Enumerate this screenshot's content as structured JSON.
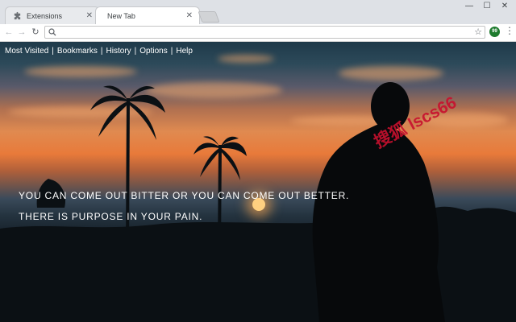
{
  "tabs": [
    {
      "label": "Extensions",
      "icon": "puzzle-icon",
      "active": false
    },
    {
      "label": "New Tab",
      "active": true
    }
  ],
  "toolbar": {
    "back": "←",
    "forward": "→",
    "reload": "↻",
    "address_value": "",
    "address_placeholder": "",
    "star": "☆",
    "extension_badge": "99",
    "menu": "⋮"
  },
  "window_controls": {
    "minimize": "—",
    "maximize": "☐",
    "close": "✕"
  },
  "nav": [
    {
      "label": "Most Visited"
    },
    {
      "label": "Bookmarks"
    },
    {
      "label": "History"
    },
    {
      "label": "Options"
    },
    {
      "label": "Help"
    }
  ],
  "quote": {
    "line1": "YOU CAN COME OUT BITTER OR YOU CAN COME OUT BETTER.",
    "line2": "THERE IS PURPOSE IN YOUR PAIN."
  },
  "watermark": "搜狐 lscs66",
  "colors": {
    "tabstrip": "#dee1e6",
    "extension_badge": "#1e7b2e",
    "watermark": "#c8102e"
  }
}
